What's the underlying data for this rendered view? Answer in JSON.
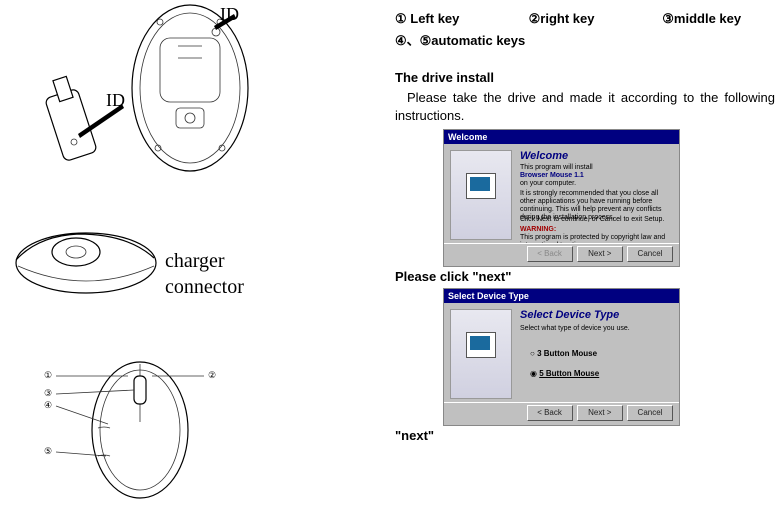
{
  "left": {
    "id_label_top": "ID",
    "id_label_side": "ID",
    "charger_line1": "charger",
    "charger_line2": "connector",
    "callouts": {
      "c1": "①",
      "c2": "②",
      "c3": "③",
      "c4": "④",
      "c5": "⑤"
    }
  },
  "right": {
    "key1": "①  Left key",
    "key2": "②right key",
    "key3": "③middle key",
    "key45": "④、⑤automatic keys",
    "drive_title": "The drive install",
    "drive_text_line1": "Please take the drive and made it according to the following",
    "drive_text_line2": "instructions.",
    "click_next1": "Please click \"next\"",
    "click_next2": "\"next\""
  },
  "screenshot1": {
    "titlebar": "Welcome",
    "heading": "Welcome",
    "sub": "This program will install",
    "product": "Browser Mouse 1.1",
    "on": "on your computer.",
    "rec": "It is strongly recommended that you close all other applications you have running before continuing. This will help prevent any conflicts during the installation process.",
    "cont": "Click Next to continue, or Cancel to exit Setup.",
    "warning_label": "WARNING:",
    "warning": "This program is protected by copyright law and international treaties.",
    "btn_back": "< Back",
    "btn_next": "Next >",
    "btn_cancel": "Cancel"
  },
  "screenshot2": {
    "titlebar": "Select Device Type",
    "heading": "Select Device Type",
    "sub": "Select what type of device you use.",
    "opt1": "3 Button Mouse",
    "opt2": "5 Button Mouse",
    "btn_back": "< Back",
    "btn_next": "Next >",
    "btn_cancel": "Cancel"
  }
}
